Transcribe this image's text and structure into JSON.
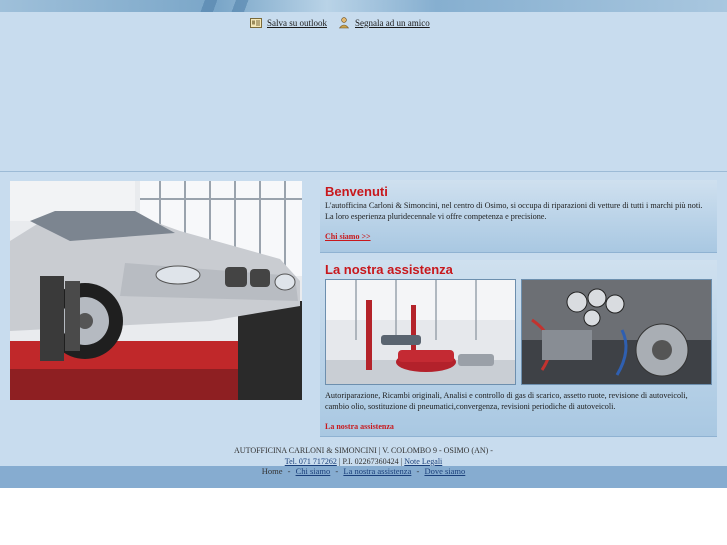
{
  "header": {
    "save_outlook_label": "Salva su outlook",
    "tell_friend_label": "Segnala ad un amico"
  },
  "welcome": {
    "title": "Benvenuti",
    "text": "L'autofficina Carloni & Simoncini, nel centro di Osimo, si occupa di riparazioni di vetture di tutti i marchi più noti. La loro esperienza pluridecennale vi offre competenza e precisione.",
    "link": "Chi siamo >>"
  },
  "assistance": {
    "title": "La nostra assistenza",
    "text": "Autoriparazione, Ricambi originali, Analisi e controllo di gas di scarico, assetto ruote, revisione di autoveicoli, cambio olio, sostituzione di pneumatici,convergenza, revisioni periodiche di autoveicoli.",
    "link": "La nostra assistenza"
  },
  "footer": {
    "line1": "AUTOFFICINA CARLONI & SIMONCINI | V. COLOMBO 9 - OSIMO (AN) -",
    "phone": "Tel. 071 717262",
    "vat": " | P.I. 02267360424 | ",
    "legal": "Note Legali"
  },
  "nav": {
    "home": "Home",
    "sep": "-",
    "chi_siamo": "Chi siamo",
    "assistenza": "La nostra assistenza",
    "dove": "Dove siamo"
  },
  "colors": {
    "accent_red": "#c8181c",
    "panel_blue": "#c8dcee",
    "bar_blue": "#86acd0"
  }
}
